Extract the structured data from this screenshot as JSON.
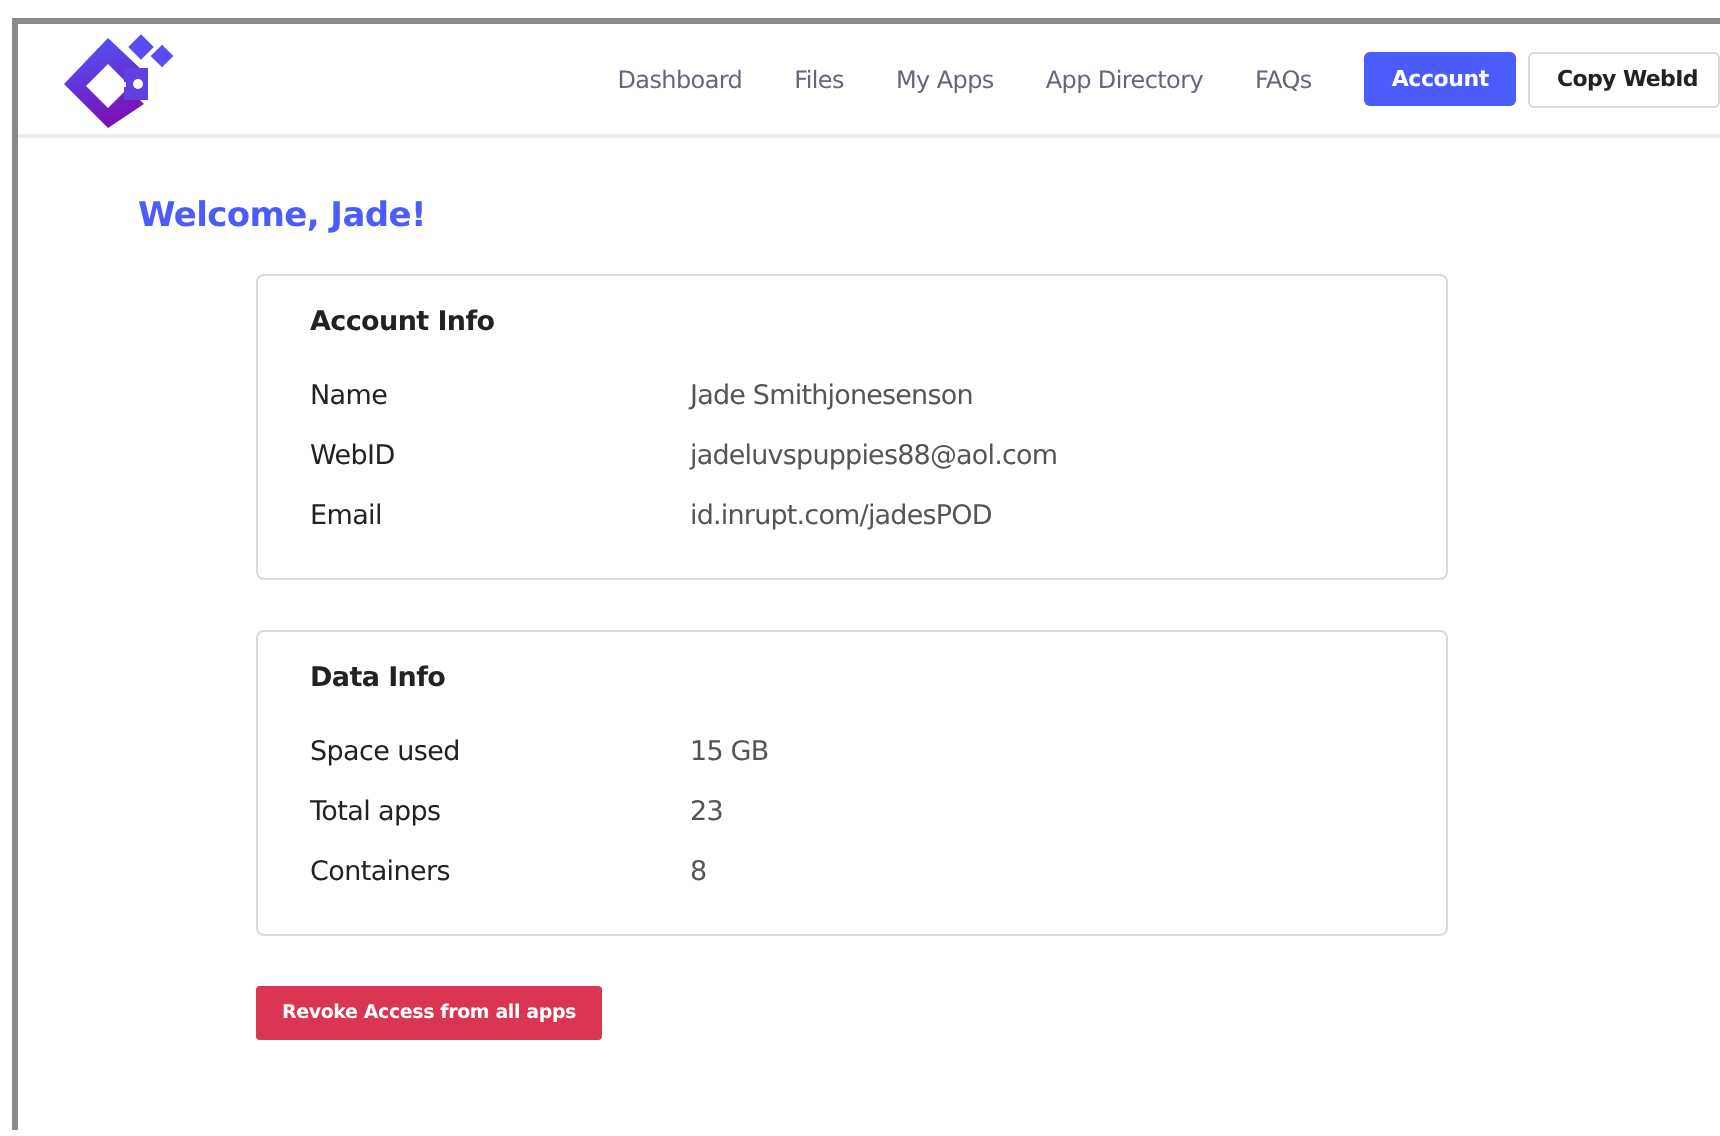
{
  "nav": {
    "items": [
      {
        "label": "Dashboard",
        "selected": false
      },
      {
        "label": "Files",
        "selected": false
      },
      {
        "label": "My Apps",
        "selected": false
      },
      {
        "label": "App Directory",
        "selected": false
      },
      {
        "label": "FAQs",
        "selected": false
      },
      {
        "label": "Account",
        "selected": true
      }
    ],
    "action_button": "Copy WebId"
  },
  "heading": "Welcome, Jade!",
  "cards": [
    {
      "title": "Account Info",
      "rows": [
        {
          "label": "Name",
          "value": "Jade Smithjonesenson"
        },
        {
          "label": "WebID",
          "value": "jadeluvspuppies88@aol.com"
        },
        {
          "label": "Email",
          "value": "id.inrupt.com/jadesPOD"
        }
      ]
    },
    {
      "title": "Data Info",
      "rows": [
        {
          "label": "Space used",
          "value": "15 GB"
        },
        {
          "label": "Total apps",
          "value": "23"
        },
        {
          "label": "Containers",
          "value": "8"
        }
      ]
    }
  ],
  "revoke_button": "Revoke Access from all apps"
}
